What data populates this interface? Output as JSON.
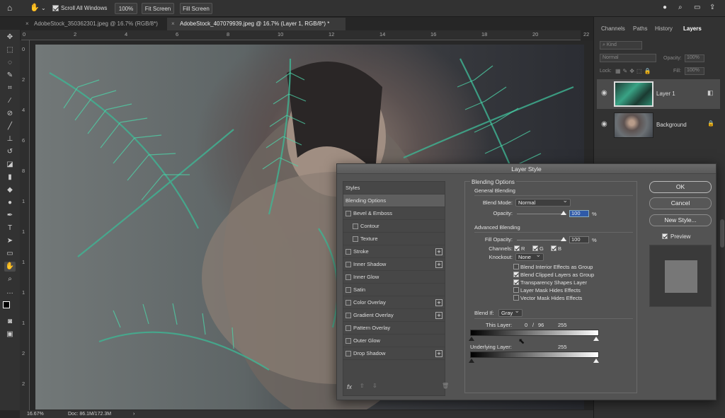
{
  "options_bar": {
    "scroll_all_windows_label": "Scroll All Windows",
    "zoom_button": "100%",
    "fit_screen": "Fit Screen",
    "fill_screen": "Fill Screen"
  },
  "tabs": [
    {
      "label": "AdobeStock_350362301.jpeg @ 16.7% (RGB/8*)"
    },
    {
      "label": "AdobeStock_407079939.jpeg @ 16.7% (Layer 1, RGB/8*) *"
    }
  ],
  "ruler_top": [
    "0",
    "2",
    "4",
    "6",
    "8",
    "10",
    "12",
    "14",
    "16",
    "18",
    "20",
    "22"
  ],
  "ruler_left": [
    "0",
    "2",
    "4",
    "6",
    "8",
    "1",
    "1",
    "1",
    "1",
    "1",
    "2",
    "2"
  ],
  "status": {
    "zoom": "16.67%",
    "doc": "Doc: 86.1M/172.3M",
    "arrow": "›"
  },
  "panel": {
    "tabs": [
      "Channels",
      "Paths",
      "History",
      "Layers"
    ],
    "kind": "Kind",
    "blend_mode": "Normal",
    "opacity_label": "Opacity:",
    "opacity_value": "100%",
    "lock_label": "Lock:",
    "fill_label": "Fill:",
    "fill_value": "100%",
    "layers": [
      {
        "name": "Layer 1"
      },
      {
        "name": "Background"
      }
    ]
  },
  "dialog": {
    "title": "Layer Style",
    "styles": [
      {
        "label": "Styles",
        "checkbox": false,
        "plus": false,
        "indent": false,
        "selected": false
      },
      {
        "label": "Blending Options",
        "checkbox": false,
        "plus": false,
        "indent": false,
        "selected": true
      },
      {
        "label": "Bevel & Emboss",
        "checkbox": true,
        "plus": false,
        "indent": false
      },
      {
        "label": "Contour",
        "checkbox": true,
        "plus": false,
        "indent": true
      },
      {
        "label": "Texture",
        "checkbox": true,
        "plus": false,
        "indent": true
      },
      {
        "label": "Stroke",
        "checkbox": true,
        "plus": true,
        "indent": false
      },
      {
        "label": "Inner Shadow",
        "checkbox": true,
        "plus": true,
        "indent": false
      },
      {
        "label": "Inner Glow",
        "checkbox": true,
        "plus": false,
        "indent": false
      },
      {
        "label": "Satin",
        "checkbox": true,
        "plus": false,
        "indent": false
      },
      {
        "label": "Color Overlay",
        "checkbox": true,
        "plus": true,
        "indent": false
      },
      {
        "label": "Gradient Overlay",
        "checkbox": true,
        "plus": true,
        "indent": false
      },
      {
        "label": "Pattern Overlay",
        "checkbox": true,
        "plus": false,
        "indent": false
      },
      {
        "label": "Outer Glow",
        "checkbox": true,
        "plus": false,
        "indent": false
      },
      {
        "label": "Drop Shadow",
        "checkbox": true,
        "plus": true,
        "indent": false
      }
    ],
    "fx_label": "fx",
    "blending_options": "Blending Options",
    "general_blending": "General Blending",
    "blend_mode_label": "Blend Mode:",
    "blend_mode_value": "Normal",
    "opacity_label": "Opacity:",
    "opacity_value": "100",
    "pct": "%",
    "advanced_blending": "Advanced Blending",
    "fill_opacity_label": "Fill Opacity:",
    "fill_opacity_value": "100",
    "channels_label": "Channels:",
    "channel_r": "R",
    "channel_g": "G",
    "channel_b": "B",
    "knockout_label": "Knockout:",
    "knockout_value": "None",
    "options": [
      {
        "label": "Blend Interior Effects as Group",
        "checked": false
      },
      {
        "label": "Blend Clipped Layers as Group",
        "checked": true
      },
      {
        "label": "Transparency Shapes Layer",
        "checked": true
      },
      {
        "label": "Layer Mask Hides Effects",
        "checked": false
      },
      {
        "label": "Vector Mask Hides Effects",
        "checked": false
      }
    ],
    "blend_if_label": "Blend If:",
    "blend_if_value": "Gray",
    "this_layer_label": "This Layer:",
    "this_layer_low": "0",
    "this_layer_slash": "/",
    "this_layer_mid": "96",
    "this_layer_high": "255",
    "underlying_label": "Underlying Layer:",
    "underlying_low": "0",
    "underlying_high": "255",
    "ok": "OK",
    "cancel": "Cancel",
    "new_style": "New Style...",
    "preview_label": "Preview"
  }
}
